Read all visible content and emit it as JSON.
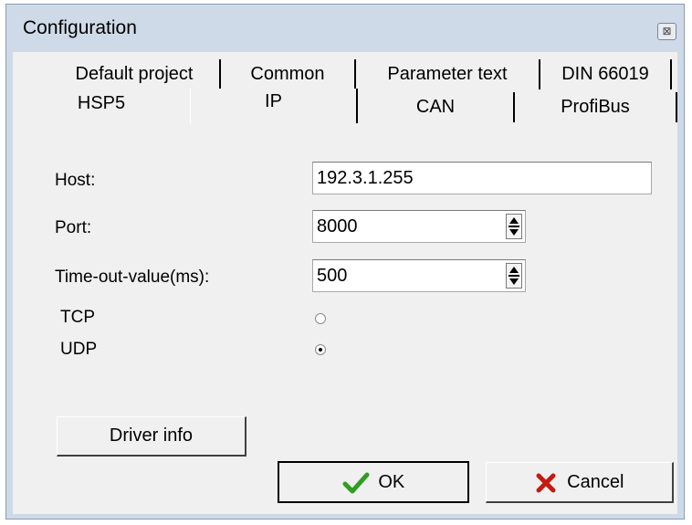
{
  "window": {
    "title": "Configuration",
    "close_glyph": "⊠"
  },
  "tabs_row1": [
    "Default project",
    "Common",
    "Parameter text",
    "DIN 66019"
  ],
  "tabs_row2": [
    "HSP5",
    "IP",
    "CAN",
    "ProfiBus"
  ],
  "active_tab": "IP",
  "form": {
    "host_label": "Host:",
    "host_value": "192.3.1.255",
    "port_label": "Port:",
    "port_value": "8000",
    "timeout_label": "Time-out-value(ms):",
    "timeout_value": "500",
    "tcp_label": "TCP",
    "tcp_selected": false,
    "udp_label": "UDP",
    "udp_selected": true
  },
  "buttons": {
    "driver_info": "Driver info",
    "ok": "OK",
    "cancel": "Cancel"
  },
  "colors": {
    "ok_check": "#2e9e1e",
    "cancel_x": "#c41a12",
    "title_bg": "#cfdae8"
  },
  "icons": {
    "ok": "check-icon",
    "cancel": "x-icon",
    "close": "close-icon"
  }
}
